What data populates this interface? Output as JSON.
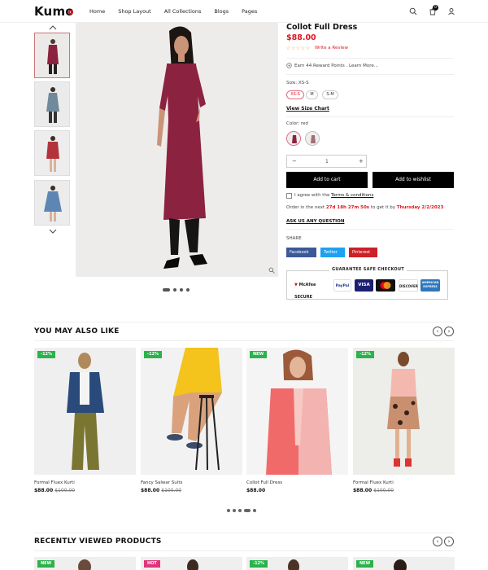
{
  "header": {
    "logo": "Kumo",
    "nav": [
      "Home",
      "Shop Layout",
      "All Collections",
      "Blogs",
      "Pages"
    ],
    "cart_count": "0",
    "icons": [
      "search-icon",
      "cart-icon",
      "user-icon"
    ]
  },
  "product": {
    "title": "Collot Full Dress",
    "price": "$88.00",
    "rating_stars": "☆☆☆☆☆",
    "write_review": "Write a Review",
    "reward": "Earn 44 Reward Points . Learn More...",
    "size_label": "Size: XS-S",
    "sizes": [
      "XS-S",
      "M",
      "S-M"
    ],
    "view_size_chart": "View Size Chart",
    "color_label": "Color: red",
    "quantity": "1",
    "qty_minus": "−",
    "qty_plus": "+",
    "add_to_cart": "Add to cart",
    "add_to_wishlist": "Add to wishlist",
    "agree_prefix": "I agree with the",
    "terms": "Terms & conditions",
    "order_prefix": "Order in the next",
    "order_time": "27d 18h 27m 50s",
    "order_middle": "to get it by",
    "order_date": "Thursday 2/2/2023",
    "ask": "ASK US ANY QUESTION",
    "share_label": "SHARE",
    "share": [
      "Facebook",
      "Twitter",
      "Pinterest"
    ],
    "guarantee_title": "GUARANTEE SAFE CHECKOUT",
    "payments": [
      "McAfee SECURE",
      "PayPal",
      "VISA",
      "MasterCard",
      "DISCOVER",
      "AMERICAN EXPRESS"
    ]
  },
  "colors": {
    "accent_red": "#e0161e",
    "badge_green": "#2bb24c",
    "badge_pink": "#e0357a",
    "facebook": "#3b5998",
    "twitter": "#1da1f2",
    "pinterest": "#cb2027",
    "dress": "#8b2340"
  },
  "you_may_also_like": {
    "title": "YOU MAY ALSO LIKE",
    "prev": "‹",
    "next": "›",
    "items": [
      {
        "badge": "-12%",
        "name": "Formal Fluex Kurti",
        "price": "$88.00",
        "old_price": "$100.00"
      },
      {
        "badge": "-12%",
        "name": "Fancy Salwar Suits",
        "price": "$88.00",
        "old_price": "$100.00"
      },
      {
        "badge": "NEW",
        "name": "Collot Full Dress",
        "price": "$88.00",
        "old_price": ""
      },
      {
        "badge": "-12%",
        "name": "Formal Fluex Kurti",
        "price": "$88.00",
        "old_price": "$100.00"
      }
    ]
  },
  "recently_viewed": {
    "title": "RECENTLY VIEWED PRODUCTS",
    "prev": "‹",
    "next": "›",
    "items": [
      {
        "badge": "NEW"
      },
      {
        "badge": "HOT"
      },
      {
        "badge": "-12%"
      },
      {
        "badge": "NEW"
      }
    ]
  }
}
